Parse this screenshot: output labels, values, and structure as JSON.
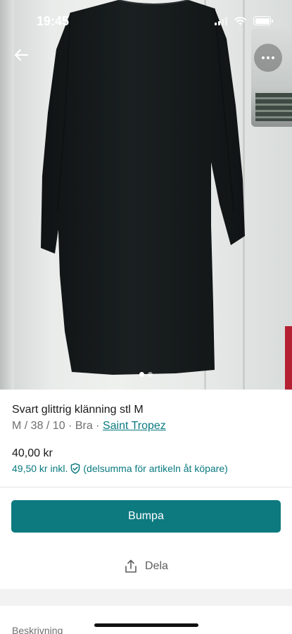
{
  "status_bar": {
    "time": "19:45"
  },
  "gallery": {
    "photo_count": 2,
    "active_index": 0,
    "photo_subject": "black dress on hanger"
  },
  "listing": {
    "title": "Svart glittrig klänning stl M",
    "meta_prefix": "M / 38 / 10 · Bra · ",
    "brand": "Saint Tropez",
    "price": "40,00 kr",
    "price_incl_amount": "49,50 kr inkl.",
    "price_incl_note": "(delsumma för artikeln åt köpare)"
  },
  "actions": {
    "bump_label": "Bumpa",
    "share_label": "Dela"
  },
  "sections": {
    "description_label": "Beskrivning"
  },
  "colors": {
    "accent": "#0d7a80",
    "dress": "#15191a"
  },
  "icons": [
    "back-arrow-icon",
    "more-options-icon",
    "shield-check-icon",
    "share-icon",
    "wifi-icon",
    "signal-icon",
    "battery-icon"
  ]
}
